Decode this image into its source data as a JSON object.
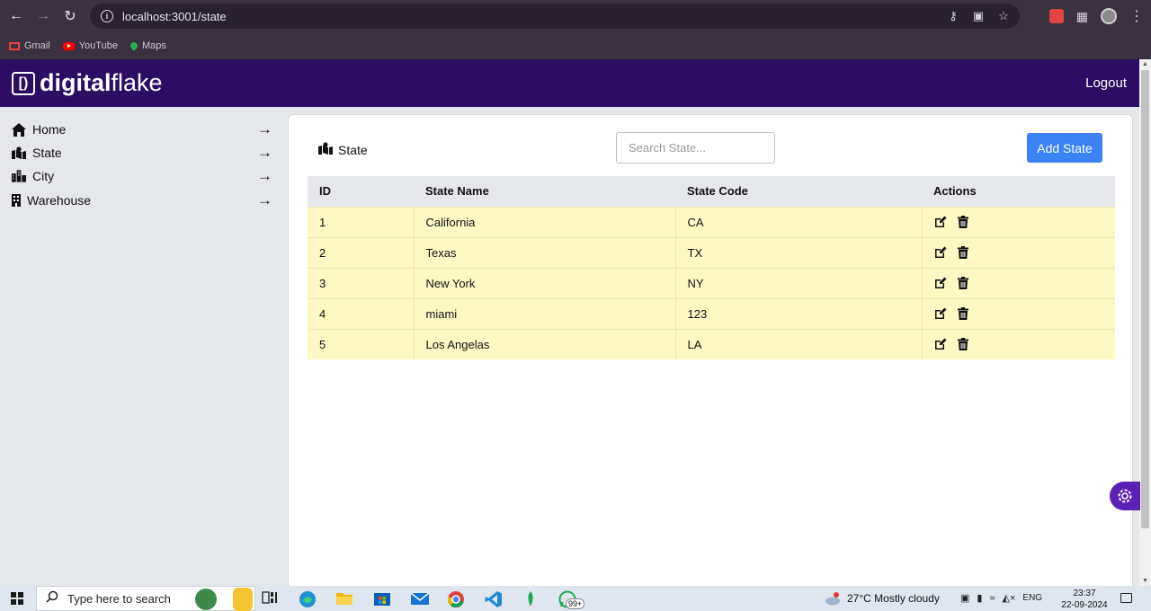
{
  "browser": {
    "url": "localhost:3001/state",
    "bookmarks": [
      {
        "label": "Gmail"
      },
      {
        "label": "YouTube"
      },
      {
        "label": "Maps"
      }
    ]
  },
  "header": {
    "logo_bracket": "[)",
    "logo_bold": "digital",
    "logo_rest": "flake",
    "logout_label": "Logout"
  },
  "sidebar": {
    "items": [
      {
        "label": "Home",
        "icon": "home-icon"
      },
      {
        "label": "State",
        "icon": "map-icon"
      },
      {
        "label": "City",
        "icon": "city-icon"
      },
      {
        "label": "Warehouse",
        "icon": "warehouse-icon"
      }
    ]
  },
  "main": {
    "title": "State",
    "search_placeholder": "Search State...",
    "add_label": "Add State",
    "columns": [
      "ID",
      "State Name",
      "State Code",
      "Actions"
    ],
    "rows": [
      {
        "id": "1",
        "name": "California",
        "code": "CA"
      },
      {
        "id": "2",
        "name": "Texas",
        "code": "TX"
      },
      {
        "id": "3",
        "name": "New York",
        "code": "NY"
      },
      {
        "id": "4",
        "name": "miami",
        "code": "123"
      },
      {
        "id": "5",
        "name": "Los Angelas",
        "code": "LA"
      }
    ]
  },
  "taskbar": {
    "search_placeholder": "Type here to search",
    "weather": "27°C  Mostly cloudy",
    "language": "ENG",
    "time": "23:37",
    "date": "22-09-2024",
    "whatsapp_badge": "99+"
  },
  "colors": {
    "header_bg": "#2b0d63",
    "accent_button": "#3b82f6",
    "row_bg": "#fef9c3",
    "sidebar_bg": "#e5e7eb"
  }
}
